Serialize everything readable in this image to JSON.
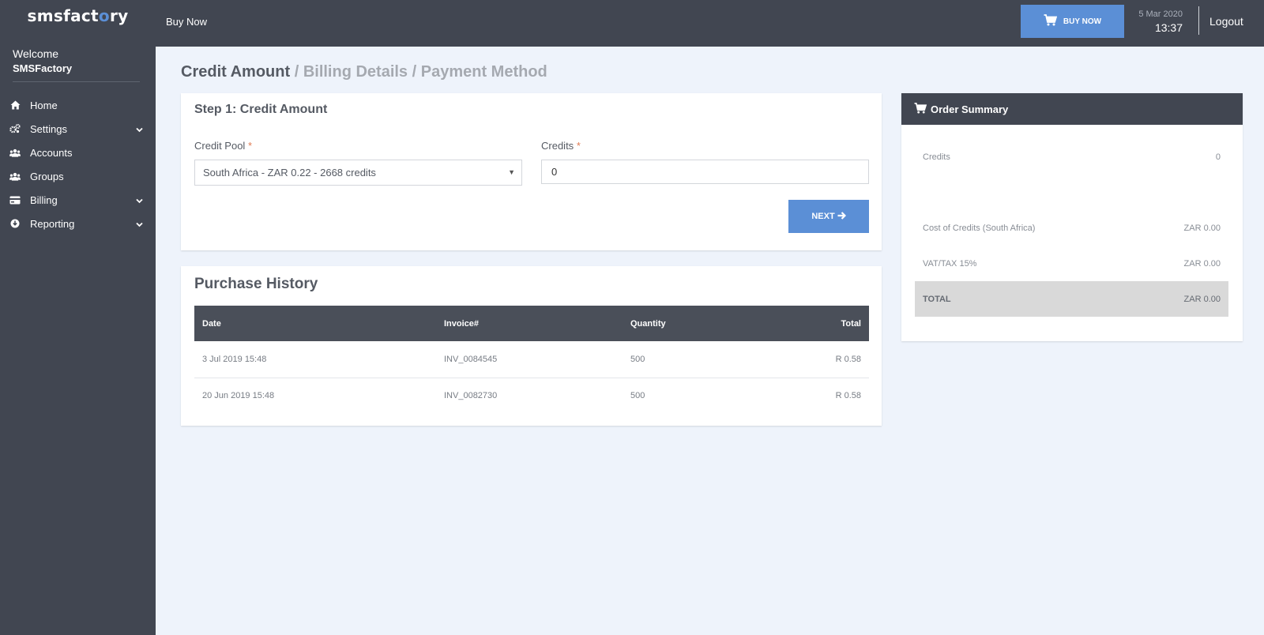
{
  "brand": {
    "logo_pre": "smsfact",
    "logo_o": "o",
    "logo_post": "ry"
  },
  "user": {
    "welcome": "Welcome",
    "name": "SMSFactory"
  },
  "sidebar": {
    "items": [
      {
        "label": "Home",
        "icon": "home-icon"
      },
      {
        "label": "Settings",
        "icon": "cogs-icon",
        "expandable": true
      },
      {
        "label": "Accounts",
        "icon": "users-icon"
      },
      {
        "label": "Groups",
        "icon": "users-icon"
      },
      {
        "label": "Billing",
        "icon": "credit-card-icon",
        "expandable": true
      },
      {
        "label": "Reporting",
        "icon": "download-circle-icon",
        "expandable": true
      }
    ]
  },
  "topbar": {
    "breadcrumb": "Buy Now",
    "buy_label": "BUY NOW",
    "date": "5 Mar 2020",
    "time": "13:37",
    "logout": "Logout"
  },
  "steps": {
    "active": "Credit Amount",
    "sep1": " / ",
    "step2": "Billing Details",
    "sep2": " / ",
    "step3": "Payment Method"
  },
  "credit_form": {
    "heading": "Step 1: Credit Amount",
    "pool_label": "Credit Pool",
    "pool_value": "South Africa - ZAR 0.22 -  2668 credits",
    "credits_label": "Credits",
    "credits_value": "0",
    "required_mark": "*",
    "next_label": "NEXT"
  },
  "history": {
    "heading": "Purchase History",
    "columns": [
      "Date",
      "Invoice#",
      "Quantity",
      "Total"
    ],
    "rows": [
      [
        "3 Jul 2019 15:48",
        "INV_0084545",
        "500",
        "R 0.58"
      ],
      [
        "20 Jun 2019 15:48",
        "INV_0082730",
        "500",
        "R 0.58"
      ]
    ]
  },
  "summary": {
    "heading": "Order Summary",
    "credits_label": "Credits",
    "credits_value": "0",
    "cost_label": "Cost of Credits (South Africa)",
    "cost_value": "ZAR 0.00",
    "vat_label": "VAT/TAX 15%",
    "vat_value": "ZAR 0.00",
    "total_label": "TOTAL",
    "total_value": "ZAR 0.00"
  },
  "colors": {
    "sidebar": "#414651",
    "accent": "#5b8fd6",
    "background": "#eef3fb",
    "required": "#e07b53"
  }
}
